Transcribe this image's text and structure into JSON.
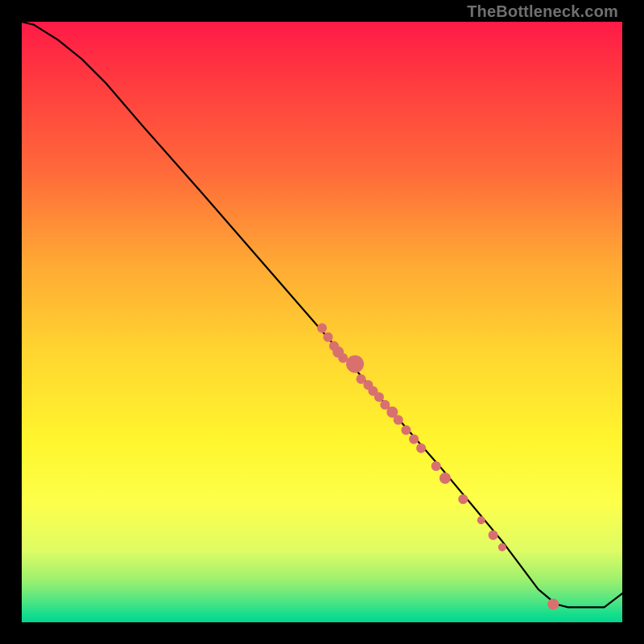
{
  "attribution": "TheBottleneck.com",
  "chart_data": {
    "type": "scatter",
    "title": "",
    "xlabel": "",
    "ylabel": "",
    "xlim": [
      0,
      100
    ],
    "ylim": [
      0,
      100
    ],
    "curve": [
      {
        "x": 0.0,
        "y": 100.0
      },
      {
        "x": 2.0,
        "y": 99.5
      },
      {
        "x": 6.0,
        "y": 97.0
      },
      {
        "x": 10.0,
        "y": 93.8
      },
      {
        "x": 14.0,
        "y": 89.8
      },
      {
        "x": 20.0,
        "y": 82.8
      },
      {
        "x": 30.0,
        "y": 71.5
      },
      {
        "x": 40.0,
        "y": 60.0
      },
      {
        "x": 50.0,
        "y": 48.5
      },
      {
        "x": 60.0,
        "y": 37.0
      },
      {
        "x": 70.0,
        "y": 25.5
      },
      {
        "x": 80.0,
        "y": 13.5
      },
      {
        "x": 86.0,
        "y": 5.5
      },
      {
        "x": 89.0,
        "y": 3.0
      },
      {
        "x": 91.0,
        "y": 2.5
      },
      {
        "x": 97.0,
        "y": 2.5
      },
      {
        "x": 100.0,
        "y": 4.8
      }
    ],
    "points": [
      {
        "x": 50.0,
        "y": 49.0,
        "r": 6
      },
      {
        "x": 51.0,
        "y": 47.5,
        "r": 6
      },
      {
        "x": 52.0,
        "y": 46.0,
        "r": 6
      },
      {
        "x": 52.7,
        "y": 45.0,
        "r": 7
      },
      {
        "x": 53.5,
        "y": 44.0,
        "r": 6
      },
      {
        "x": 55.5,
        "y": 43.0,
        "r": 11
      },
      {
        "x": 56.5,
        "y": 40.5,
        "r": 6
      },
      {
        "x": 57.7,
        "y": 39.5,
        "r": 6
      },
      {
        "x": 58.5,
        "y": 38.5,
        "r": 6
      },
      {
        "x": 59.5,
        "y": 37.5,
        "r": 6
      },
      {
        "x": 60.5,
        "y": 36.2,
        "r": 6
      },
      {
        "x": 61.7,
        "y": 35.0,
        "r": 7
      },
      {
        "x": 62.7,
        "y": 33.7,
        "r": 6
      },
      {
        "x": 64.0,
        "y": 32.0,
        "r": 6
      },
      {
        "x": 65.3,
        "y": 30.5,
        "r": 6
      },
      {
        "x": 66.5,
        "y": 29.0,
        "r": 6
      },
      {
        "x": 69.0,
        "y": 26.0,
        "r": 6
      },
      {
        "x": 70.5,
        "y": 24.0,
        "r": 7
      },
      {
        "x": 73.5,
        "y": 20.5,
        "r": 6
      },
      {
        "x": 76.5,
        "y": 17.0,
        "r": 5
      },
      {
        "x": 78.5,
        "y": 14.5,
        "r": 6
      },
      {
        "x": 80.0,
        "y": 12.5,
        "r": 5
      },
      {
        "x": 88.5,
        "y": 3.0,
        "r": 7
      }
    ],
    "point_color": "#d97070",
    "curve_color": "#000000"
  }
}
